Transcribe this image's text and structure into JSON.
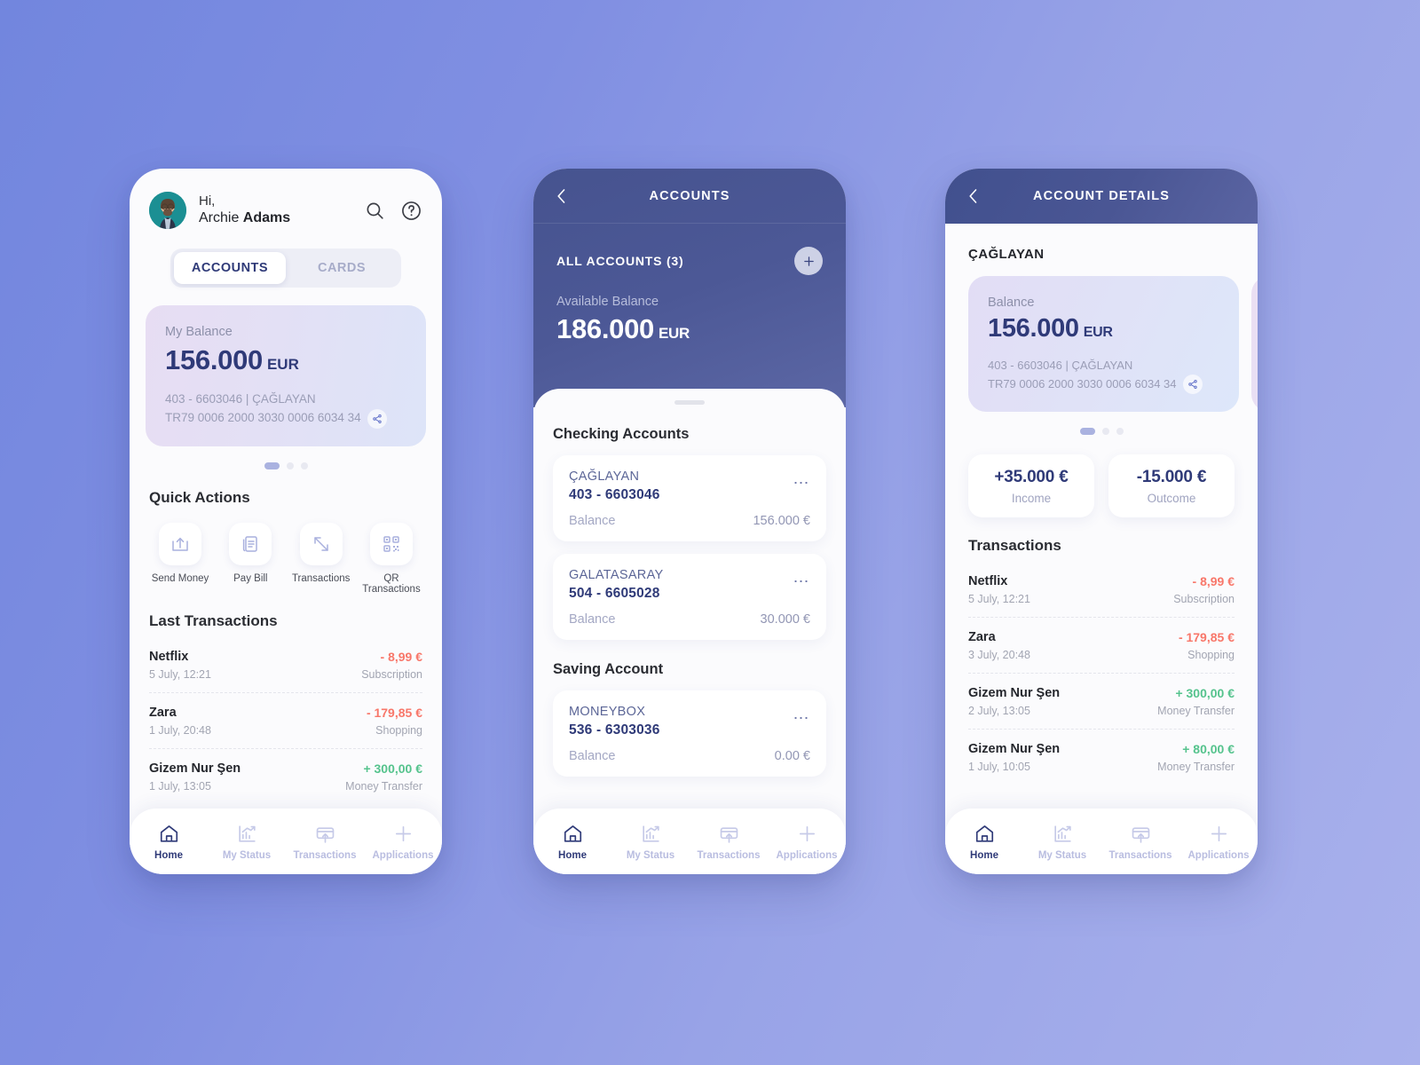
{
  "theme": {
    "background_gradient_from": "#7286de",
    "background_gradient_to": "#a9b1ec",
    "accent_navy": "#2f3a78",
    "header_navy": "#4a5694",
    "negative": "#f8776a",
    "positive": "#55c38d"
  },
  "screen1": {
    "greeting_line1": "Hi,",
    "user_first": "Archie ",
    "user_last": "Adams",
    "icons": {
      "search": "search-icon",
      "help": "help-icon"
    },
    "tabs": [
      {
        "label": "ACCOUNTS",
        "active": true
      },
      {
        "label": "CARDS",
        "active": false
      }
    ],
    "balance_card": {
      "label": "My Balance",
      "amount": "156.000",
      "currency": "EUR",
      "account_line": "403 - 6603046 | ÇAĞLAYAN",
      "iban": "TR79 0006 2000 3030 0006 6034  34",
      "share_icon": "share-icon"
    },
    "pagination": {
      "total": 3,
      "active_index": 0
    },
    "quick_actions_title": "Quick Actions",
    "quick_actions": [
      {
        "label": "Send Money",
        "icon": "upload-tray-icon"
      },
      {
        "label": "Pay Bill",
        "icon": "document-icon"
      },
      {
        "label": "Transactions",
        "icon": "exchange-arrows-icon"
      },
      {
        "label": "QR Transactions",
        "icon": "qr-code-icon"
      }
    ],
    "transactions_title": "Last Transactions",
    "transactions": [
      {
        "name": "Netflix",
        "date": "5 July,  12:21",
        "amount": "- 8,99 €",
        "category": "Subscription",
        "sign": "neg"
      },
      {
        "name": "Zara",
        "date": "1 July,  20:48",
        "amount": "- 179,85 €",
        "category": "Shopping",
        "sign": "neg"
      },
      {
        "name": "Gizem Nur Şen",
        "date": "1 July,  13:05",
        "amount": "+ 300,00 €",
        "category": "Money Transfer",
        "sign": "pos"
      }
    ]
  },
  "screen2": {
    "title": "ACCOUNTS",
    "back_icon": "chevron-left-icon",
    "all_accounts_label": "ALL ACCOUNTS (3)",
    "add_icon": "plus-icon",
    "available_label": "Available Balance",
    "available_amount": "186.000",
    "available_currency": "EUR",
    "groups": [
      {
        "title": "Checking Accounts",
        "accounts": [
          {
            "name": "ÇAĞLAYAN",
            "number": "403 - 6603046",
            "balance_label": "Balance",
            "balance_value": "156.000 €"
          },
          {
            "name": "GALATASARAY",
            "number": "504 - 6605028",
            "balance_label": "Balance",
            "balance_value": "30.000 €"
          }
        ]
      },
      {
        "title": "Saving Account",
        "accounts": [
          {
            "name": "MONEYBOX",
            "number": "536 - 6303036",
            "balance_label": "Balance",
            "balance_value": "0.00 €"
          }
        ]
      }
    ]
  },
  "screen3": {
    "title": "ACCOUNT DETAILS",
    "back_icon": "chevron-left-icon",
    "account_name": "ÇAĞLAYAN",
    "balance_card": {
      "label": "Balance",
      "amount": "156.000",
      "currency": "EUR",
      "account_line": "403 - 6603046 | ÇAĞLAYAN",
      "iban": "TR79 0006 2000 3030 0006 6034  34",
      "share_icon": "share-icon"
    },
    "pagination": {
      "total": 3,
      "active_index": 0
    },
    "stats": [
      {
        "value": "+35.000 €",
        "label": "Income"
      },
      {
        "value": "-15.000 €",
        "label": "Outcome"
      }
    ],
    "transactions_title": "Transactions",
    "transactions": [
      {
        "name": "Netflix",
        "date": "5 July,  12:21",
        "amount": "- 8,99 €",
        "category": "Subscription",
        "sign": "neg"
      },
      {
        "name": "Zara",
        "date": "3 July,  20:48",
        "amount": "- 179,85 €",
        "category": "Shopping",
        "sign": "neg"
      },
      {
        "name": "Gizem Nur Şen",
        "date": "2 July,  13:05",
        "amount": "+ 300,00 €",
        "category": "Money Transfer",
        "sign": "pos"
      },
      {
        "name": "Gizem Nur Şen",
        "date": "1 July,  10:05",
        "amount": "+ 80,00 €",
        "category": "Money Transfer",
        "sign": "pos"
      }
    ]
  },
  "bottom_nav": [
    {
      "label": "Home",
      "icon": "home-icon",
      "active": true
    },
    {
      "label": "My Status",
      "icon": "bar-chart-icon",
      "active": false
    },
    {
      "label": "Transactions",
      "icon": "card-upload-icon",
      "active": false
    },
    {
      "label": "Applications",
      "icon": "plus-icon",
      "active": false
    }
  ]
}
